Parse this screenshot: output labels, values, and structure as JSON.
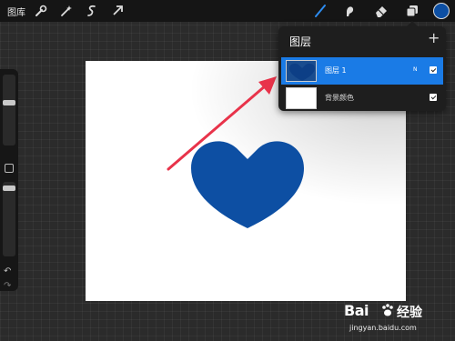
{
  "toolbar": {
    "gallery_label": "图库",
    "left_tools": [
      "wrench-icon",
      "magic-wand-icon",
      "selection-icon",
      "transform-arrow-icon"
    ],
    "right_tools": [
      "brush-icon",
      "smudge-icon",
      "eraser-icon",
      "layers-icon"
    ],
    "active_tool": "brush-icon",
    "accent_color": "#1a7be6",
    "current_color": "#0d4fa3"
  },
  "sidebar": {
    "items": [
      "brush-size-slider",
      "modify-button",
      "opacity-slider",
      "undo-button",
      "redo-button"
    ],
    "undo_glyph": "↶",
    "redo_glyph": "↷"
  },
  "canvas": {
    "background": "#ffffff",
    "shape": "heart-icon",
    "shape_color": "#0d4fa3",
    "annotation_color": "#e8334a"
  },
  "layers_panel": {
    "title": "图层",
    "add_glyph": "+",
    "layers": [
      {
        "name": "图层 1",
        "blend_mode": "N",
        "visible": true,
        "selected": true
      },
      {
        "name": "背景颜色",
        "blend_mode": "",
        "visible": true,
        "selected": false
      }
    ]
  },
  "watermark": {
    "logo_text": "Bai",
    "site_text": "经验",
    "url": "jingyan.baidu.com"
  }
}
